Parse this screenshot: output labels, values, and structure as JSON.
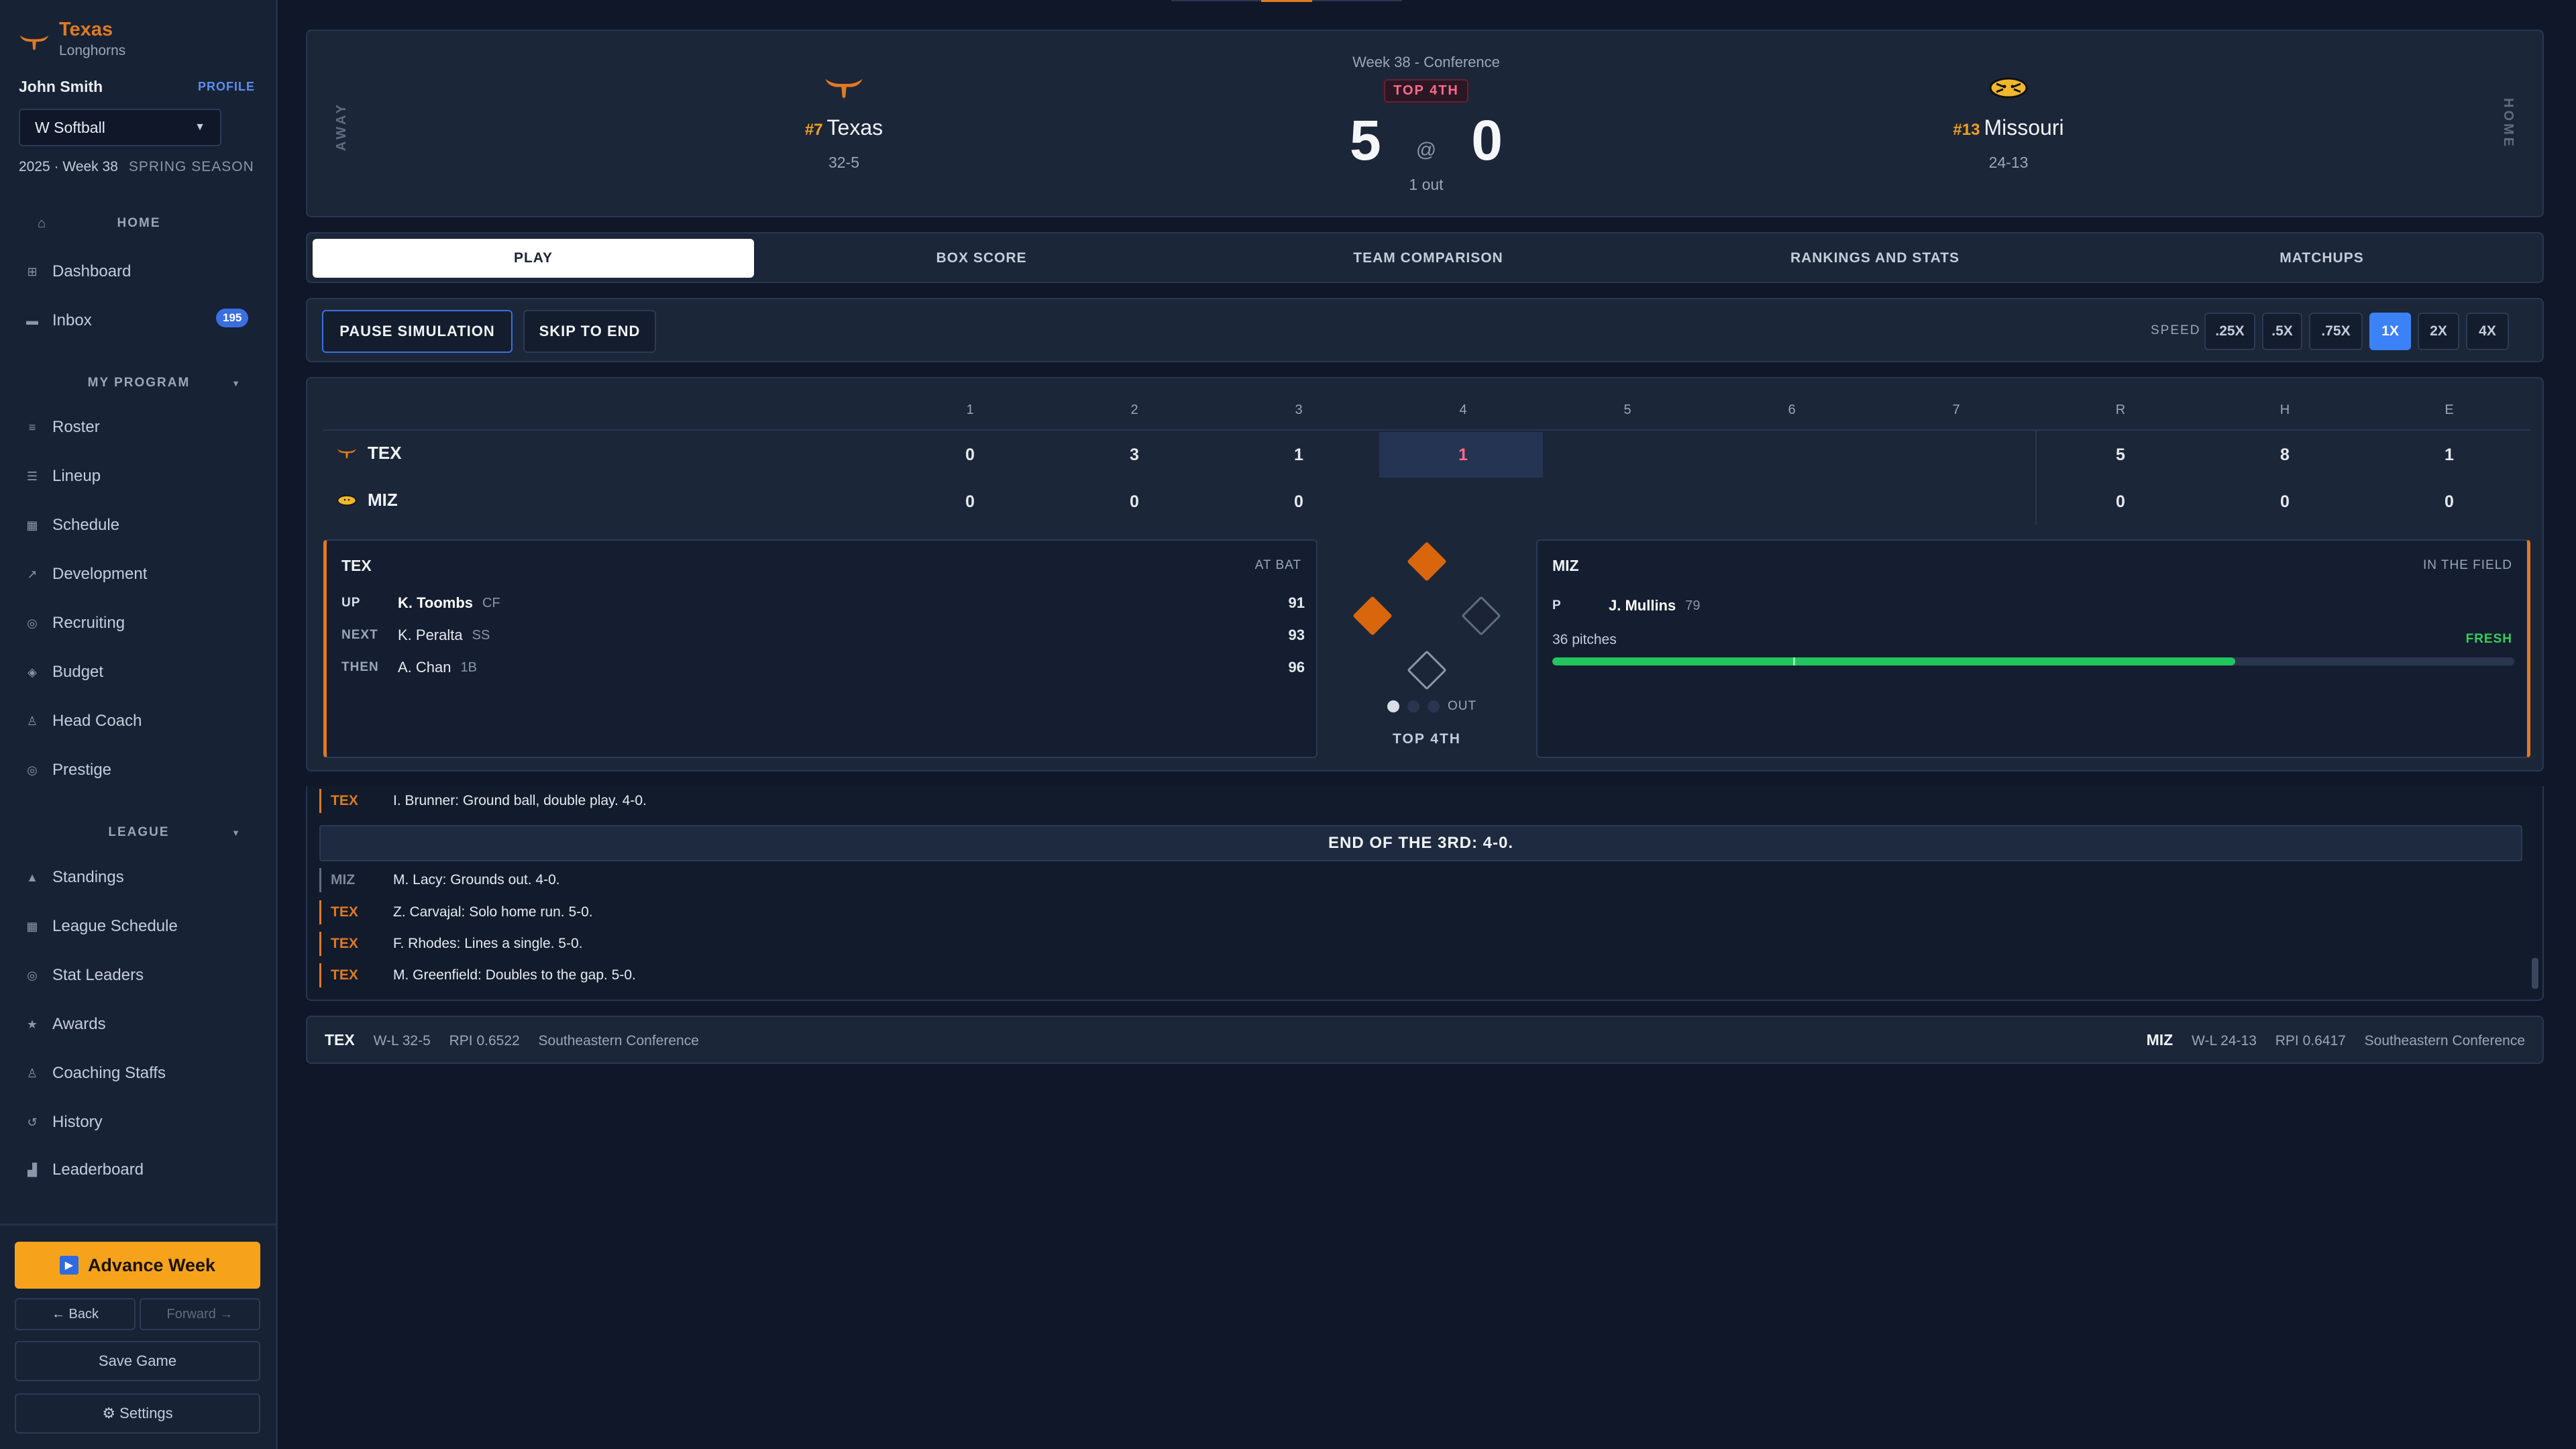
{
  "sidebar": {
    "brand_name": "Texas",
    "brand_sub": "Longhorns",
    "user_name": "John Smith",
    "profile_label": "PROFILE",
    "sport": "W Softball",
    "season_year_week": "2025 · Week 38",
    "season_label": "SPRING SEASON",
    "home_label": "HOME",
    "items_top": [
      {
        "label": "Dashboard",
        "icon": "grid-icon"
      },
      {
        "label": "Inbox",
        "icon": "mail-icon",
        "badge": "195"
      }
    ],
    "my_program_label": "MY PROGRAM",
    "program_items": [
      {
        "label": "Roster",
        "icon": "list-icon"
      },
      {
        "label": "Lineup",
        "icon": "lines-icon"
      },
      {
        "label": "Schedule",
        "icon": "calendar-icon"
      },
      {
        "label": "Development",
        "icon": "trend-icon"
      },
      {
        "label": "Recruiting",
        "icon": "target-icon"
      },
      {
        "label": "Budget",
        "icon": "diamond-icon"
      },
      {
        "label": "Head Coach",
        "icon": "person-icon"
      },
      {
        "label": "Prestige",
        "icon": "badge-icon"
      }
    ],
    "league_label": "LEAGUE",
    "league_items": [
      {
        "label": "Standings",
        "icon": "triangle-icon"
      },
      {
        "label": "League Schedule",
        "icon": "calendar-icon"
      },
      {
        "label": "Stat Leaders",
        "icon": "target-icon"
      },
      {
        "label": "Awards",
        "icon": "star-icon"
      },
      {
        "label": "Coaching Staffs",
        "icon": "person-icon"
      },
      {
        "label": "History",
        "icon": "history-icon"
      },
      {
        "label": "Leaderboard",
        "icon": "bars-icon"
      }
    ],
    "advance_label": "Advance Week",
    "back_label": "Back",
    "forward_label": "Forward",
    "save_label": "Save Game",
    "settings_label": "Settings"
  },
  "scoreboard": {
    "away_label": "AWAY",
    "home_label": "HOME",
    "week": "Week 38 - Conference",
    "inning": "TOP 4TH",
    "away": {
      "rank": "#7",
      "name": "Texas",
      "record": "32-5",
      "score": "5"
    },
    "home": {
      "rank": "#13",
      "name": "Missouri",
      "record": "24-13",
      "score": "0"
    },
    "at": "@",
    "outs_text": "1 out"
  },
  "tabs": [
    "PLAY",
    "BOX SCORE",
    "TEAM COMPARISON",
    "RANKINGS AND STATS",
    "MATCHUPS"
  ],
  "controls": {
    "pause_label": "PAUSE SIMULATION",
    "skip_label": "SKIP TO END",
    "speed_label": "SPEED",
    "speeds": [
      ".25X",
      ".5X",
      ".75X",
      "1X",
      "2X",
      "4X"
    ],
    "active_speed": "1X"
  },
  "linescore": {
    "headers": [
      "1",
      "2",
      "3",
      "4",
      "5",
      "6",
      "7",
      "R",
      "H",
      "E"
    ],
    "teams": [
      {
        "abbr": "TEX",
        "innings": [
          "0",
          "3",
          "1",
          "1",
          "",
          "",
          ""
        ],
        "r": "5",
        "h": "8",
        "e": "1"
      },
      {
        "abbr": "MIZ",
        "innings": [
          "0",
          "0",
          "0",
          "",
          "",
          "",
          ""
        ],
        "r": "0",
        "h": "0",
        "e": "0"
      }
    ]
  },
  "at_bat": {
    "team": "TEX",
    "tag": "AT BAT",
    "rows": [
      {
        "slot": "UP",
        "name": "K. Toombs",
        "pos": "CF",
        "ovr": "91"
      },
      {
        "slot": "NEXT",
        "name": "K. Peralta",
        "pos": "SS",
        "ovr": "93"
      },
      {
        "slot": "THEN",
        "name": "A. Chan",
        "pos": "1B",
        "ovr": "96"
      }
    ]
  },
  "field": {
    "team": "MIZ",
    "tag": "IN THE FIELD",
    "pitcher_slot": "P",
    "pitcher_name": "J. Mullins",
    "pitcher_ovr": "79",
    "pitches": "36 pitches",
    "status": "FRESH",
    "stamina_pct": 71,
    "marker_pct": 25
  },
  "diamond": {
    "outs_label": "OUT",
    "outs": 1,
    "inning_label": "TOP 4TH",
    "bases": {
      "first": false,
      "second": true,
      "third": true
    }
  },
  "pbp": {
    "rows_top": [
      {
        "team": "TEX",
        "text": "I. Brunner: Ground ball, double play. 4-0."
      }
    ],
    "end_banner": "END OF THE 3RD: 4-0.",
    "rows": [
      {
        "team": "MIZ",
        "text": "M. Lacy: Grounds out. 4-0."
      },
      {
        "team": "TEX",
        "text": "Z. Carvajal: Solo home run. 5-0."
      },
      {
        "team": "TEX",
        "text": "F. Rhodes: Lines a single. 5-0."
      },
      {
        "team": "TEX",
        "text": "M. Greenfield: Doubles to the gap. 5-0."
      }
    ]
  },
  "footer": {
    "away": {
      "abbr": "TEX",
      "wl": "W-L 32-5",
      "rpi": "RPI 0.6522",
      "conf": "Southeastern Conference"
    },
    "home": {
      "abbr": "MIZ",
      "wl": "W-L 24-13",
      "rpi": "RPI 0.6417",
      "conf": "Southeastern Conference"
    }
  },
  "colors": {
    "texas": "#e07a1f",
    "accent": "#3b82f6",
    "advance": "#f6a31b",
    "fresh": "#22c55e"
  }
}
